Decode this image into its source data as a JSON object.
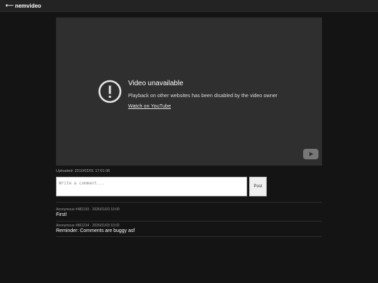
{
  "nav": {
    "back_arrow": "⟵",
    "site_name": "nemvideo"
  },
  "player": {
    "title": "Video unavailable",
    "subtitle": "Playback on other websites has been disabled by the video owner",
    "link": "Watch on YouTube",
    "icons": {
      "warning": "warning-circle-icon",
      "youtube": "youtube-logo-icon"
    }
  },
  "video": {
    "uploaded": "Uploaded: 2010/02/01 17:01:06"
  },
  "comment_form": {
    "placeholder": "Write a comment...",
    "post_label": "Post"
  },
  "comments": [
    {
      "author_time": "Anonymous #482193 · 2026/01/03 10:00",
      "text": "First!"
    },
    {
      "author_time": "Anonymous #861234 · 2026/01/03 10:02",
      "text": "Reminder: Comments are buggy asf"
    }
  ]
}
